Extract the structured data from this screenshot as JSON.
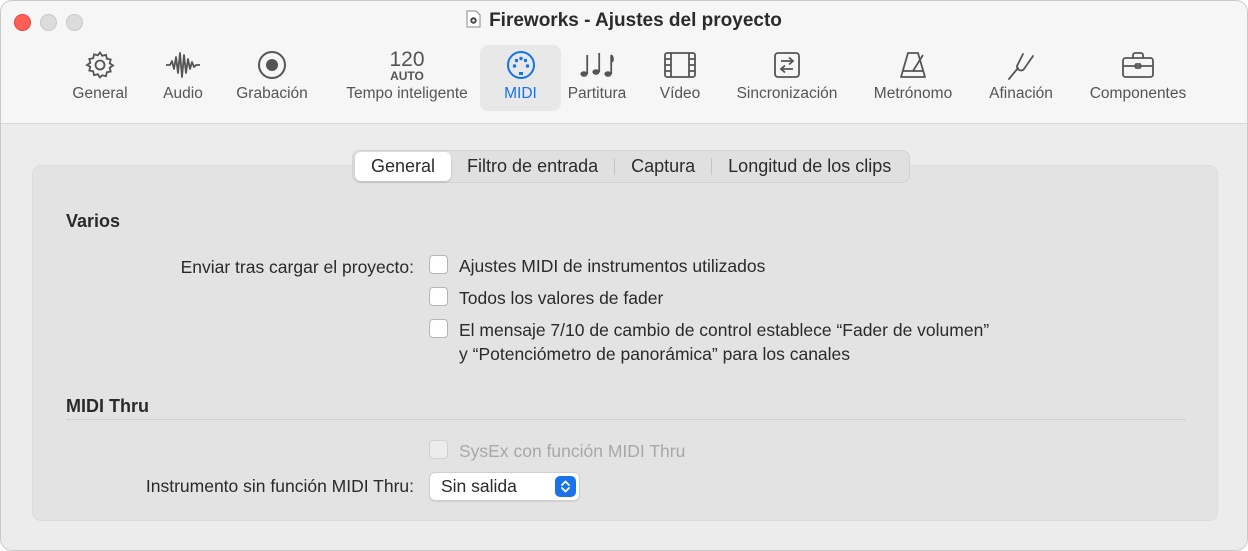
{
  "window": {
    "title": "Fireworks - Ajustes del proyecto"
  },
  "toolbar": {
    "items": [
      {
        "label": "General",
        "icon": "gear-icon"
      },
      {
        "label": "Audio",
        "icon": "waveform-icon"
      },
      {
        "label": "Grabación",
        "icon": "record-icon"
      },
      {
        "label": "Tempo inteligente",
        "icon": "tempo-icon",
        "tempo_value": "120",
        "tempo_mode": "AUTO"
      },
      {
        "label": "MIDI",
        "icon": "midi-connector-icon",
        "active": true
      },
      {
        "label": "Partitura",
        "icon": "music-notes-icon"
      },
      {
        "label": "Vídeo",
        "icon": "film-icon"
      },
      {
        "label": "Sincronización",
        "icon": "sync-icon"
      },
      {
        "label": "Metrónomo",
        "icon": "metronome-icon"
      },
      {
        "label": "Afinación",
        "icon": "tuning-fork-icon"
      },
      {
        "label": "Componentes",
        "icon": "briefcase-icon"
      }
    ],
    "accent_color": "#1673e6"
  },
  "tabs": {
    "items": [
      "General",
      "Filtro de entrada",
      "Captura",
      "Longitud de los clips"
    ],
    "selected": "General"
  },
  "varios": {
    "title": "Varios",
    "send_label": "Enviar tras cargar el proyecto:",
    "options": [
      {
        "label": "Ajustes MIDI de instrumentos utilizados",
        "checked": false
      },
      {
        "label": "Todos los valores de fader",
        "checked": false
      },
      {
        "label_line1": "El mensaje 7/10 de cambio de control establece “Fader de volumen”",
        "label_line2": "y “Potenciómetro de panorámica” para los canales",
        "checked": false
      }
    ]
  },
  "midi_thru": {
    "title": "MIDI Thru",
    "sysex_label": "SysEx con función MIDI Thru",
    "sysex_checked": false,
    "sysex_enabled": false,
    "instrument_label": "Instrumento sin función MIDI Thru:",
    "instrument_value": "Sin salida"
  }
}
